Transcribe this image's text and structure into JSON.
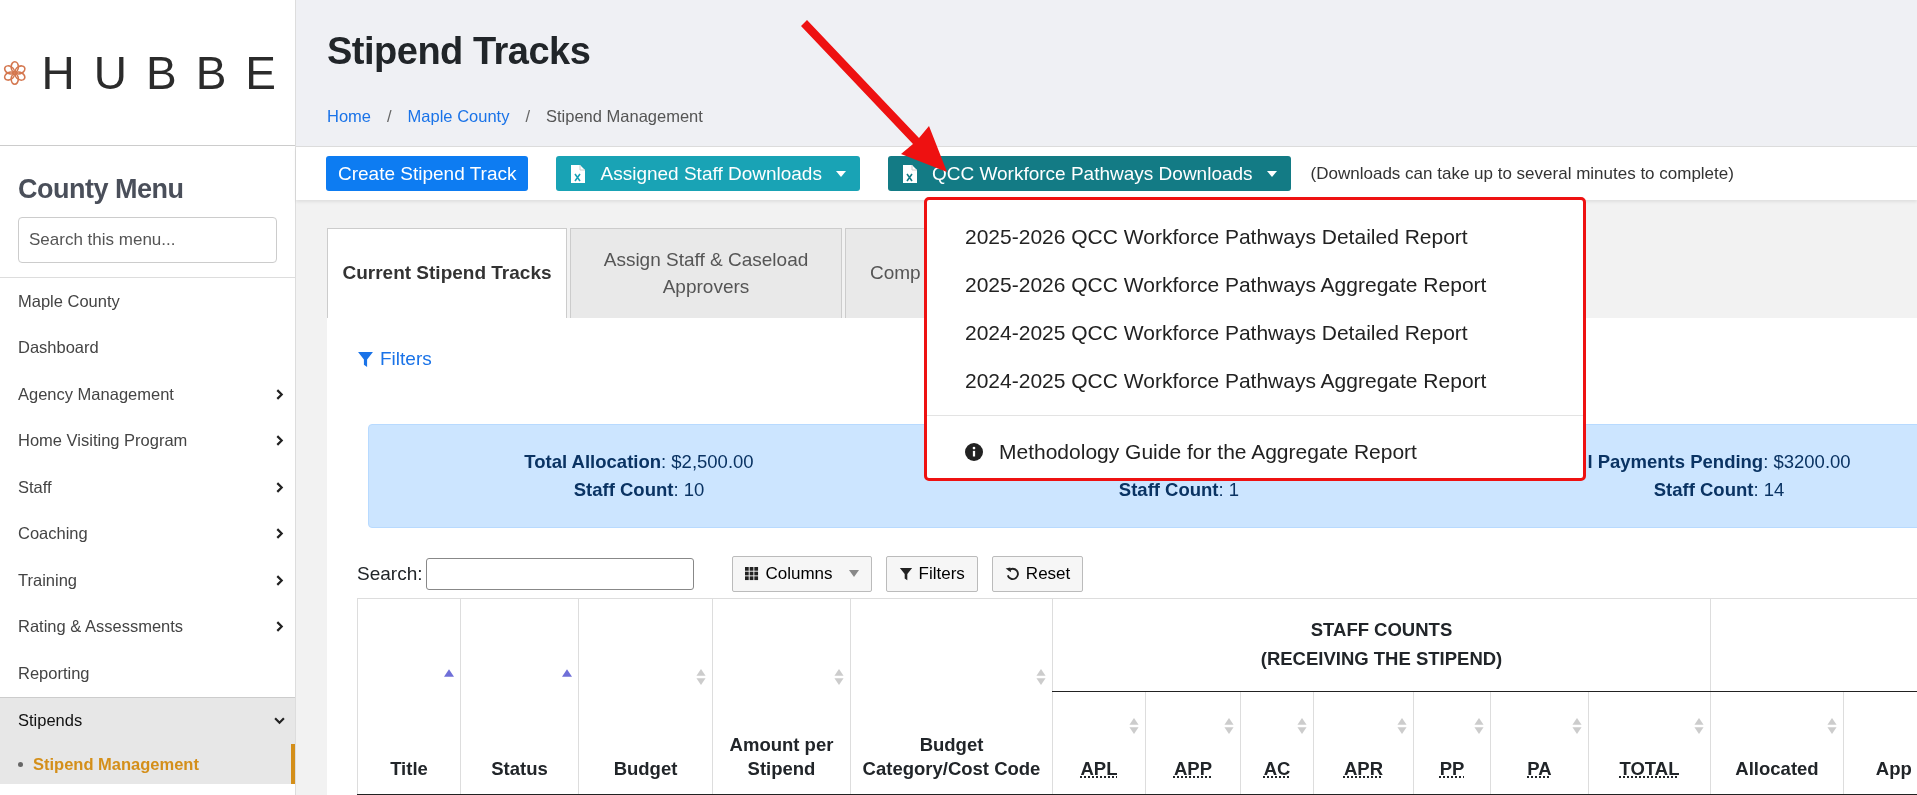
{
  "sidebar": {
    "logo_text": "HUBBE",
    "heading": "County Menu",
    "search": {
      "placeholder": "Search this menu..."
    },
    "items": [
      {
        "label": "Maple County",
        "expandable": false,
        "expanded": false,
        "selected": false
      },
      {
        "label": "Dashboard",
        "expandable": false,
        "expanded": false,
        "selected": false
      },
      {
        "label": "Agency Management",
        "expandable": true,
        "expanded": false,
        "selected": false
      },
      {
        "label": "Home Visiting Program",
        "expandable": true,
        "expanded": false,
        "selected": false
      },
      {
        "label": "Staff",
        "expandable": true,
        "expanded": false,
        "selected": false
      },
      {
        "label": "Coaching",
        "expandable": true,
        "expanded": false,
        "selected": false
      },
      {
        "label": "Training",
        "expandable": true,
        "expanded": false,
        "selected": false
      },
      {
        "label": "Rating & Assessments",
        "expandable": true,
        "expanded": false,
        "selected": false
      },
      {
        "label": "Reporting",
        "expandable": false,
        "expanded": false,
        "selected": false
      },
      {
        "label": "Stipends",
        "expandable": true,
        "expanded": true,
        "selected": false,
        "children": [
          {
            "label": "Stipend Management",
            "selected": true
          }
        ]
      }
    ]
  },
  "page": {
    "title": "Stipend Tracks",
    "breadcrumb_separator": "/",
    "breadcrumbs": [
      {
        "label": "Home",
        "link": true
      },
      {
        "label": "Maple County",
        "link": true
      },
      {
        "label": "Stipend Management",
        "link": false
      }
    ]
  },
  "toolbar": {
    "buttons": [
      {
        "label": "Create Stipend Track",
        "kind": "primary",
        "expanded": false
      },
      {
        "label": "Assigned Staff Downloads",
        "kind": "download",
        "expanded": false
      },
      {
        "label": "QCC Workforce Pathways Downloads",
        "kind": "download",
        "expanded": true
      }
    ],
    "note": "(Downloads can take up to several minutes to complete)"
  },
  "dropdown": {
    "items": [
      {
        "label": "2025-2026 QCC Workforce Pathways Detailed Report",
        "kind": "report"
      },
      {
        "label": "2025-2026 QCC Workforce Pathways Aggregate Report",
        "kind": "report"
      },
      {
        "label": "2024-2025 QCC Workforce Pathways Detailed Report",
        "kind": "report"
      },
      {
        "label": "2024-2025 QCC Workforce Pathways Aggregate Report",
        "kind": "report"
      },
      {
        "label": "Methodology Guide for the Aggregate Report",
        "kind": "guide"
      }
    ]
  },
  "tabs": [
    {
      "label": "Current Stipend Tracks",
      "selected": true
    },
    {
      "label": "Assign Staff & Caseload Approvers",
      "selected": false
    },
    {
      "label": "Comp",
      "selected": false
    }
  ],
  "filters_link": "Filters",
  "summary": [
    {
      "lines": [
        "**Total Allocation**: $2,500.00",
        "**Staff Count**: 10"
      ]
    },
    {
      "lines": [
        "**Staff Count**: 1"
      ]
    },
    {
      "lines": [
        "**l Payments Pending**: $3200.00",
        "**Staff Count**: 14"
      ]
    }
  ],
  "table_tools": {
    "search_label": "Search:",
    "buttons": [
      {
        "label": "Columns",
        "kind": "columns"
      },
      {
        "label": "Filters",
        "kind": "filters"
      },
      {
        "label": "Reset",
        "kind": "reset"
      }
    ]
  },
  "table": {
    "columns": [
      {
        "label": "Title",
        "sorted": true
      },
      {
        "label": "Status",
        "sorted": true
      },
      {
        "label": "Budget",
        "sorted": false
      },
      {
        "label": "Amount per Stipend",
        "sorted": false
      },
      {
        "label": "Budget Category/Cost Code",
        "sorted": false
      }
    ],
    "groups": [
      {
        "lines": [
          "STAFF COUNTS",
          "(RECEIVING THE STIPEND)"
        ],
        "columns": [
          {
            "label": "APL",
            "sorted": false
          },
          {
            "label": "APP",
            "sorted": false
          },
          {
            "label": "AC",
            "sorted": false
          },
          {
            "label": "APR",
            "sorted": false
          },
          {
            "label": "PP",
            "sorted": false
          },
          {
            "label": "PA",
            "sorted": false
          },
          {
            "label": "TOTAL",
            "sorted": false
          }
        ]
      },
      {
        "columns": [
          {
            "label": "Allocated",
            "sorted": false
          },
          {
            "label": "App"
          }
        ]
      }
    ]
  }
}
